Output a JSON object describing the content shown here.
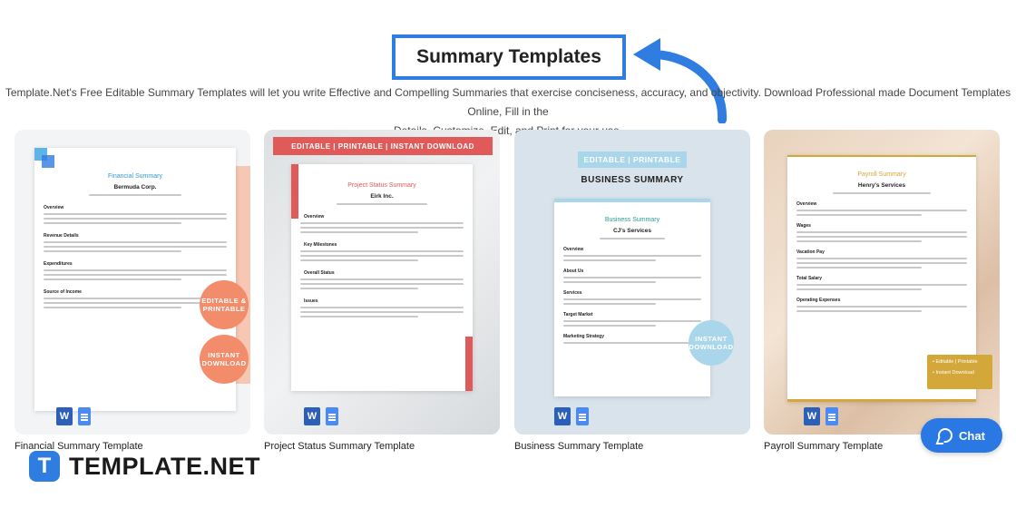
{
  "page": {
    "title": "Summary Templates",
    "intro_line1": "Template.Net's Free Editable Summary Templates will let you write Effective and Compelling Summaries that exercise conciseness, accuracy, and objectivity. Download Professional made Document Templates Online, Fill in the",
    "intro_line2": "Details, Customize, Edit, and Print for your use."
  },
  "cards": [
    {
      "label": "Financial Summary Template",
      "doc_title": "Financial Summary",
      "company": "Bermuda Corp.",
      "badge1": "EDITABLE & PRINTABLE",
      "badge2": "INSTANT DOWNLOAD",
      "sections": [
        "Overview",
        "Revenue Details",
        "Expenditures",
        "Source of Income"
      ]
    },
    {
      "label": "Project Status Summary Template",
      "banner": "EDITABLE | PRINTABLE | INSTANT DOWNLOAD",
      "doc_title": "Project Status Summary",
      "company": "Eirk Inc.",
      "sections": [
        "Overview",
        "Key Milestones",
        "Overall Status",
        "Issues"
      ]
    },
    {
      "label": "Business Summary Template",
      "ribbon": "EDITABLE | PRINTABLE",
      "heading": "BUSINESS SUMMARY",
      "doc_title": "Business Summary",
      "company": "CJ's Services",
      "badge": "INSTANT DOWNLOAD",
      "sections": [
        "Overview",
        "About Us",
        "Services",
        "Target Market",
        "Marketing Strategy"
      ]
    },
    {
      "label": "Payroll Summary Template",
      "doc_title": "Payroll Summary",
      "company": "Henry's Services",
      "tag1": "• Editable | Printable",
      "tag2": "• Instant Download",
      "sections": [
        "Overview",
        "Wages",
        "Vacation Pay",
        "Total Salary",
        "Operating Expenses"
      ]
    }
  ],
  "chat": {
    "label": "Chat"
  },
  "brand": {
    "mark": "T",
    "name": "TEMPLATE.NET"
  },
  "colors": {
    "accent": "#2f7de0",
    "salmon": "#f28c6a",
    "red": "#e05a5a",
    "teal": "#2a9d8f",
    "gold": "#d4a73a",
    "light_blue": "#a9d6ea"
  }
}
